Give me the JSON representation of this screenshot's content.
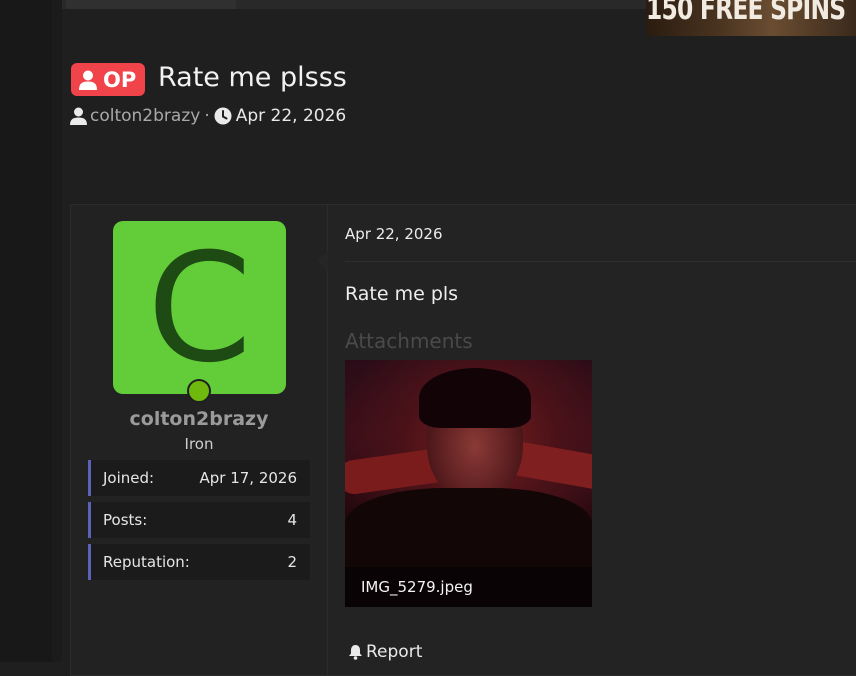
{
  "ad": {
    "text": "150 FREE SPINS"
  },
  "thread": {
    "op_badge": "OP",
    "title": "Rate me plsss",
    "author": "colton2brazy",
    "separator": "·",
    "date": "Apr 22, 2026"
  },
  "user": {
    "avatar_letter": "C",
    "username": "colton2brazy",
    "rank": "Iron",
    "stats": [
      {
        "label": "Joined:",
        "value": "Apr 17, 2026"
      },
      {
        "label": "Posts:",
        "value": "4"
      },
      {
        "label": "Reputation:",
        "value": "2"
      }
    ]
  },
  "post": {
    "date": "Apr 22, 2026",
    "body": "Rate me pls",
    "attachments_label": "Attachments",
    "attachment_name": "IMG_5279.jpeg",
    "report_label": "Report"
  },
  "colors": {
    "op_badge": "#f0434a",
    "avatar_bg": "#62cd39",
    "online_dot": "#6fb80d",
    "stat_accent": "#5b63b5"
  }
}
